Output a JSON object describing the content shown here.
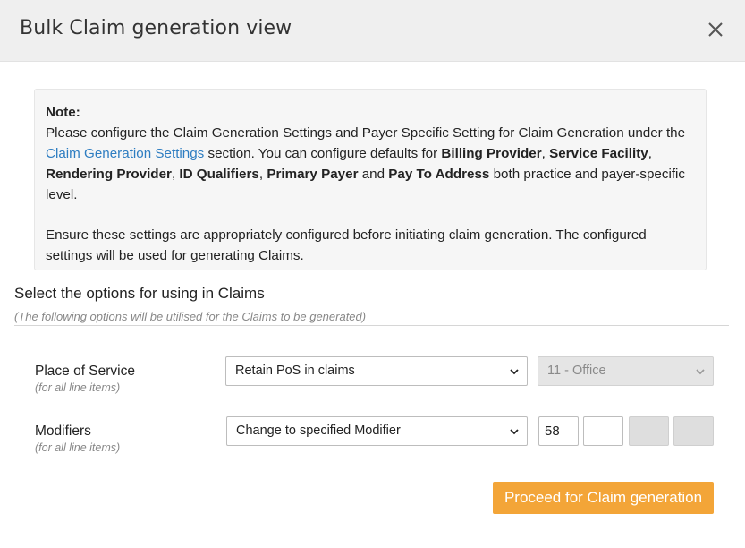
{
  "dialog": {
    "title": "Bulk Claim generation view"
  },
  "note": {
    "heading": "Note:",
    "text_1": "Please configure the Claim Generation Settings and Payer Specific Setting for Claim Generation under the ",
    "link_label": "Claim Generation Settings",
    "text_2": " section. You can configure defaults for ",
    "bold_1": "Billing Provider",
    "sep_1": ", ",
    "bold_2": "Service Facility",
    "sep_2": ", ",
    "bold_3": "Rendering Provider",
    "sep_3": ", ",
    "bold_4": "ID Qualifiers",
    "sep_4": ", ",
    "bold_5": "Primary Payer",
    "sep_5": " and ",
    "bold_6": "Pay To Address",
    "text_3": " both practice and payer-specific level.",
    "paragraph_2": "Ensure these settings are appropriately configured before initiating claim generation. The configured settings will be used for generating Claims."
  },
  "options": {
    "title": "Select the options for using in Claims",
    "subtitle": "(The following options will be utilised for the Claims to be generated)"
  },
  "place_of_service": {
    "label": "Place of Service",
    "sublabel": "(for all line items)",
    "select_value": "Retain PoS in claims",
    "code_value": "11 - Office"
  },
  "modifiers": {
    "label": "Modifiers",
    "sublabel": "(for all line items)",
    "select_value": "Change to specified Modifier",
    "modifier_1": "58",
    "modifier_2": "",
    "modifier_3": "",
    "modifier_4": ""
  },
  "actions": {
    "proceed_label": "Proceed for Claim generation"
  },
  "colors": {
    "header_bg": "#efefef",
    "link": "#2e7dc1",
    "primary_button": "#f3a538"
  }
}
